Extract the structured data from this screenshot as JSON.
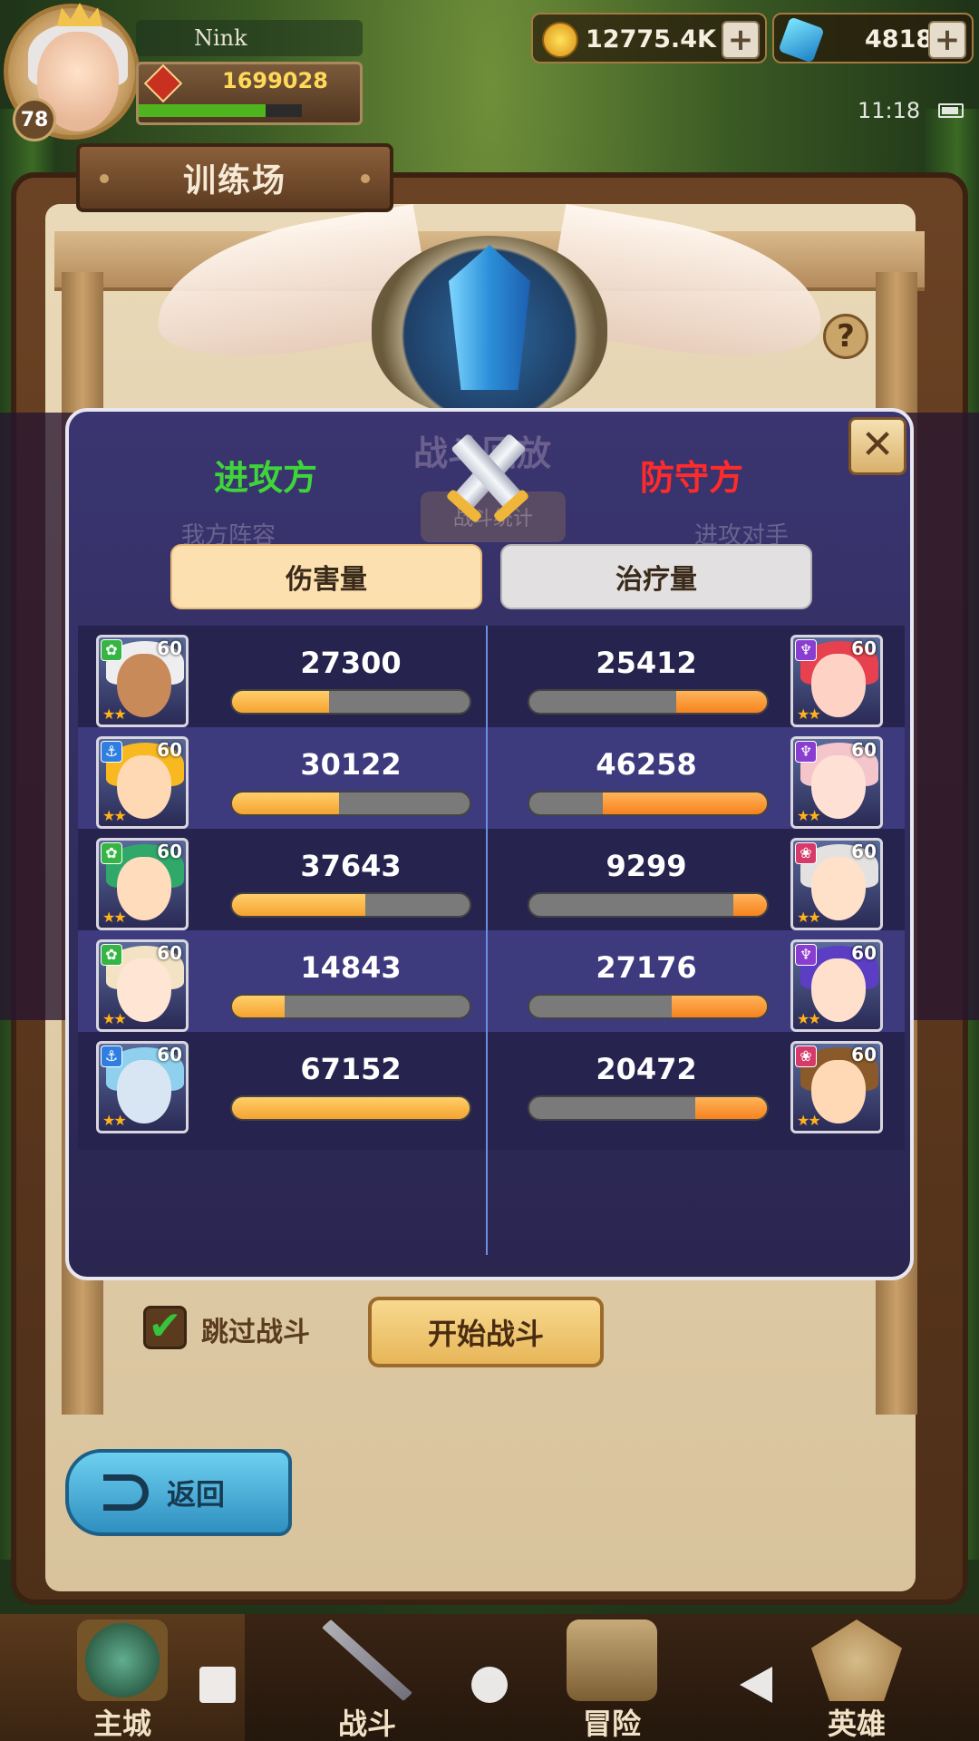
{
  "hud": {
    "player_name": "Nink",
    "player_level": "78",
    "power": "1699028",
    "xp_fraction": 0.78,
    "gold": "12775.4K",
    "gems": "4818",
    "time": "11:18",
    "plus_symbol": "+"
  },
  "page": {
    "title": "训练场",
    "help_symbol": "?"
  },
  "background": {
    "popup_title_faded": "战斗回放",
    "my_lineup_faded": "我方阵容",
    "opponent_faded": "进攻对手",
    "stats_chip_faded": "战斗统计"
  },
  "popup": {
    "attacker_label": "进攻方",
    "defender_label": "防守方",
    "close_symbol": "✕",
    "tabs": {
      "damage": "伤害量",
      "heal": "治疗量"
    },
    "rows": [
      {
        "left": {
          "value": "27300",
          "level": "60",
          "faction": "forest",
          "fill": 0.41
        },
        "right": {
          "value": "25412",
          "level": "60",
          "faction": "dark",
          "fill": 0.38
        }
      },
      {
        "left": {
          "value": "30122",
          "level": "60",
          "faction": "anchor",
          "fill": 0.45
        },
        "right": {
          "value": "46258",
          "level": "60",
          "faction": "dark",
          "fill": 0.69
        }
      },
      {
        "left": {
          "value": "37643",
          "level": "60",
          "faction": "forest",
          "fill": 0.56
        },
        "right": {
          "value": "9299",
          "level": "60",
          "faction": "flame",
          "fill": 0.14
        }
      },
      {
        "left": {
          "value": "14843",
          "level": "60",
          "faction": "forest",
          "fill": 0.22
        },
        "right": {
          "value": "27176",
          "level": "60",
          "faction": "dark",
          "fill": 0.4
        }
      },
      {
        "left": {
          "value": "67152",
          "level": "60",
          "faction": "anchor",
          "fill": 1.0
        },
        "right": {
          "value": "20472",
          "level": "60",
          "faction": "flame",
          "fill": 0.3
        }
      }
    ]
  },
  "controls": {
    "skip_battle": "跳过战斗",
    "start_battle": "开始战斗",
    "back": "返回",
    "checkmark": "✔"
  },
  "nav": {
    "home": "主城",
    "battle": "战斗",
    "adventure": "冒险",
    "hero": "英雄"
  },
  "colors": {
    "attacker": "#3fd43a",
    "defender": "#ff2b2b",
    "popup_bg": "#2a2650",
    "left_bar": "#f5a330",
    "right_bar": "#f7821e"
  }
}
